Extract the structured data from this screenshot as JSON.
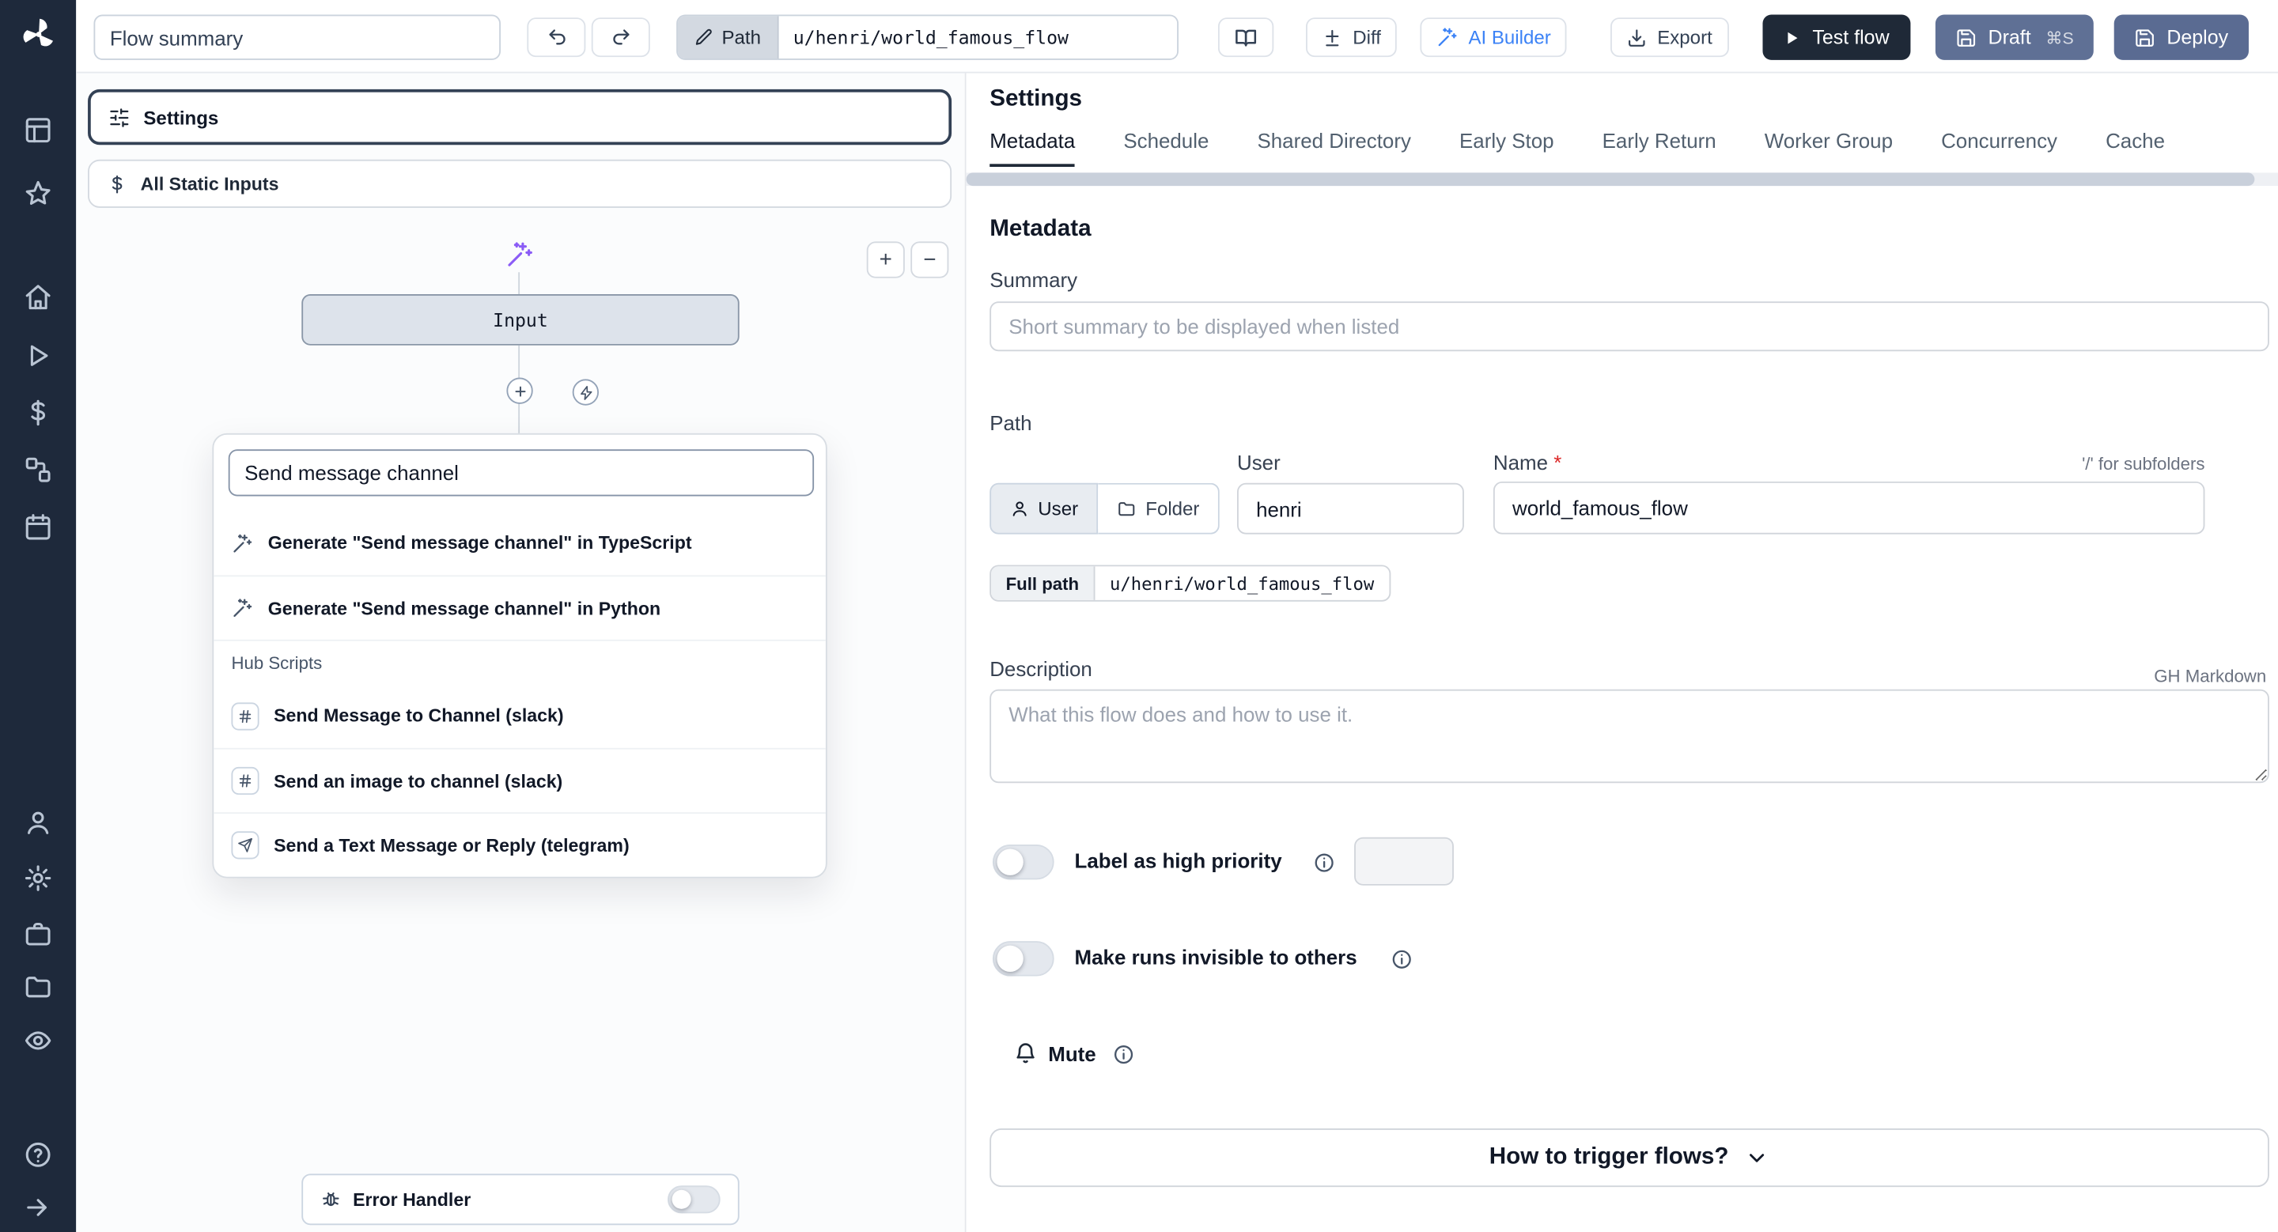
{
  "colors": {
    "accent_blue": "#3b82f6",
    "violet": "#8b5cf6",
    "sidebar_bg": "#1e293b",
    "dark_button": "#1f2937",
    "slate_button": "#5f7095"
  },
  "topbar": {
    "flow_summary_placeholder": "Flow summary",
    "path_chip": "Path",
    "path_value": "u/henri/world_famous_flow",
    "diff": "Diff",
    "ai_builder": "AI Builder",
    "export": "Export",
    "test_flow": "Test flow",
    "draft": "Draft",
    "draft_shortcut": "⌘S",
    "deploy": "Deploy"
  },
  "flow": {
    "settings": "Settings",
    "all_static_inputs": "All Static Inputs",
    "input_node": "Input",
    "error_handler": "Error Handler",
    "zoom_in": "+",
    "zoom_out": "−",
    "search": {
      "value": "Send message channel",
      "generate_ts": "Generate \"Send message channel\" in TypeScript",
      "generate_py": "Generate \"Send message channel\" in Python",
      "section": "Hub Scripts",
      "hub": [
        "Send Message to Channel (slack)",
        "Send an image to channel (slack)",
        "Send a Text Message or Reply (telegram)"
      ]
    }
  },
  "settings": {
    "title": "Settings",
    "tabs": [
      "Metadata",
      "Schedule",
      "Shared Directory",
      "Early Stop",
      "Early Return",
      "Worker Group",
      "Concurrency",
      "Cache"
    ],
    "heading": "Metadata",
    "summary_label": "Summary",
    "summary_placeholder": "Short summary to be displayed when listed",
    "path_label": "Path",
    "owner_kind_user": "User",
    "owner_kind_folder": "Folder",
    "user_label": "User",
    "user_value": "henri",
    "name_label": "Name",
    "name_required": "*",
    "name_value": "world_famous_flow",
    "subfolder_hint": "'/' for subfolders",
    "full_path_label": "Full path",
    "full_path_value": "u/henri/world_famous_flow",
    "description_label": "Description",
    "markdown_hint": "GH Markdown",
    "description_placeholder": "What this flow does and how to use it.",
    "priority_label": "Label as high priority",
    "invisible_label": "Make runs invisible to others",
    "mute_label": "Mute",
    "trigger_button": "How to trigger flows?"
  }
}
